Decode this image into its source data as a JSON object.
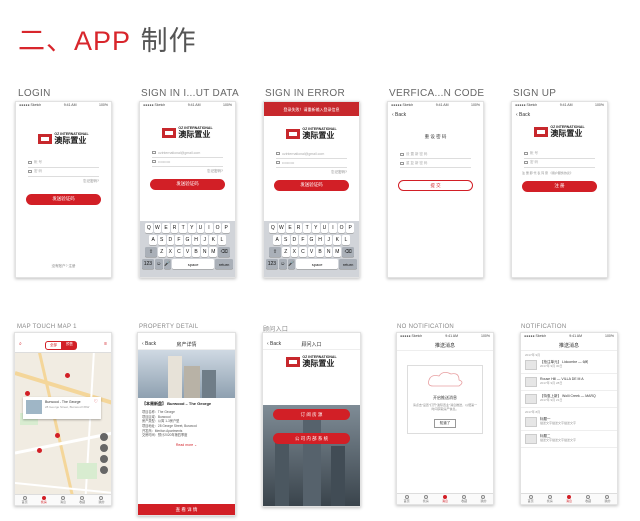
{
  "page_title": {
    "prefix": "二、APP",
    "suffix": " 制作"
  },
  "screens": {
    "login": {
      "label": "LOGIN",
      "status_left": "●●●●● Sketch",
      "status_time": "9:41 AM",
      "status_right": "100%",
      "logo_en": "OZ INTERNATIONAL",
      "logo_cn": "澳际置业",
      "field_user": "帐 号",
      "field_pass": "密 码",
      "forgot": "忘记密码?",
      "button": "发送验证码",
      "footer": "没有账户? 注册"
    },
    "signin_data": {
      "label": "SIGN IN I...UT DATA",
      "status_left": "●●●●● Sketch",
      "status_time": "9:41 AM",
      "status_right": "100%",
      "logo_en": "OZ INTERNATIONAL",
      "logo_cn": "澳际置业",
      "field_user": "ozinternational@gmail.com",
      "field_pass": "••••••••••",
      "forgot": "忘记密码?",
      "button": "发送验证码"
    },
    "signin_error": {
      "label": "SIGN IN ERROR",
      "error_text": "登录失败！请重新输入登录信息",
      "logo_en": "OZ INTERNATIONAL",
      "logo_cn": "澳际置业",
      "field_user": "ozinternational@gmail.com",
      "field_pass": "••••••••••",
      "forgot": "忘记密码?",
      "button": "发送验证码"
    },
    "verification": {
      "label": "VERFICA...N CODE",
      "status_left": "●●●●● Sketch",
      "status_time": "9:41 AM",
      "status_right": "100%",
      "back": "‹ Back",
      "heading": "重 设 密 码",
      "field_1": "设 置 新 密 码",
      "field_2": "重 复 新 密 码",
      "button": "提 交"
    },
    "signup": {
      "label": "SIGN UP",
      "status_left": "●●●●● Sketch",
      "status_time": "9:41 AM",
      "status_right": "100%",
      "back": "‹ Back",
      "logo_en": "OZ INTERNATIONAL",
      "logo_cn": "澳际置业",
      "field_1": "帐 号",
      "field_2": "密 码",
      "agree": "注 册 即 代 表 同 意 《用户服务协议》",
      "button": "注 册"
    },
    "map": {
      "label": "MAP TOUCH MAP 1",
      "tab_a": "全部",
      "tab_b": "预售",
      "card_title": "Burwood - The George",
      "card_sub": "28 George Street, Burwood NSW"
    },
    "property": {
      "label": "PROPERTY DETAIL",
      "back": "‹ Back",
      "title": "房产详情",
      "name": "【本周新盘】 Burwood – The George",
      "rows": [
        "项目名称：The George",
        "项目区域：Burwood",
        "房产类型：公寓 1-3房户型",
        "项目地址：28 George Street, Burwood",
        "开发商：Meriton Apartments",
        "交房时间：预计2020年第四季度"
      ],
      "more": "Read more ⌄",
      "button": "查 看 详 情"
    },
    "consult": {
      "label": "顾问入口",
      "back": "‹ Back",
      "title": "顾问入口",
      "logo_en": "OZ INTERNATIONAL",
      "logo_cn": "澳际置业",
      "btn_1": "订 阅 房 源",
      "btn_2": "公 司 内 部 系 统"
    },
    "no_notification": {
      "label": "NO NOTIFICATION",
      "status_left": "●●●●● Sketch",
      "status_time": "9:41 AM",
      "status_right": "100%",
      "title": "推送消息",
      "empty_title": "开启推送消息",
      "empty_text": "请点击\"设置\"打开\"澳际置业\"消息推送，以便第一时间获取房产信息。",
      "ok": "知道了"
    },
    "notification": {
      "label": "NOTIFICATION",
      "status_left": "●●●●● Sketch",
      "status_time": "9:41 AM",
      "status_right": "100%",
      "title": "推送消息",
      "section_1": "2017年 9月",
      "section_2": "2017年 8月",
      "items": [
        {
          "title": "【抢注单元】 Lidcombe — 6间",
          "sub": "2017年 9月 30日"
        },
        {
          "title": "Rouse Hill — VILLA DE M A",
          "sub": "2017年 9月 28日"
        },
        {
          "title": "【特惠上新】 Wolli Creek — MARQ",
          "sub": "2017年 9月 21日"
        },
        {
          "title": "标题一",
          "sub": "描述文字描述文字描述文字"
        },
        {
          "title": "标题二",
          "sub": "描述文字描述文字描述文字"
        }
      ]
    }
  },
  "tabbar": [
    "首页",
    "找房",
    "消息",
    "收藏",
    "我的"
  ],
  "keyboard": {
    "row1": [
      "Q",
      "W",
      "E",
      "R",
      "T",
      "Y",
      "U",
      "I",
      "O",
      "P"
    ],
    "row2": [
      "A",
      "S",
      "D",
      "F",
      "G",
      "H",
      "J",
      "K",
      "L"
    ],
    "row3": [
      "Z",
      "X",
      "C",
      "V",
      "B",
      "N",
      "M"
    ],
    "shift": "⇧",
    "delete": "⌫",
    "num": "123",
    "globe": "☺",
    "mic": "🎤",
    "space": "space",
    "return": "return"
  },
  "colors": {
    "brand_red": "#d21f26",
    "title_red": "#d8262c"
  }
}
